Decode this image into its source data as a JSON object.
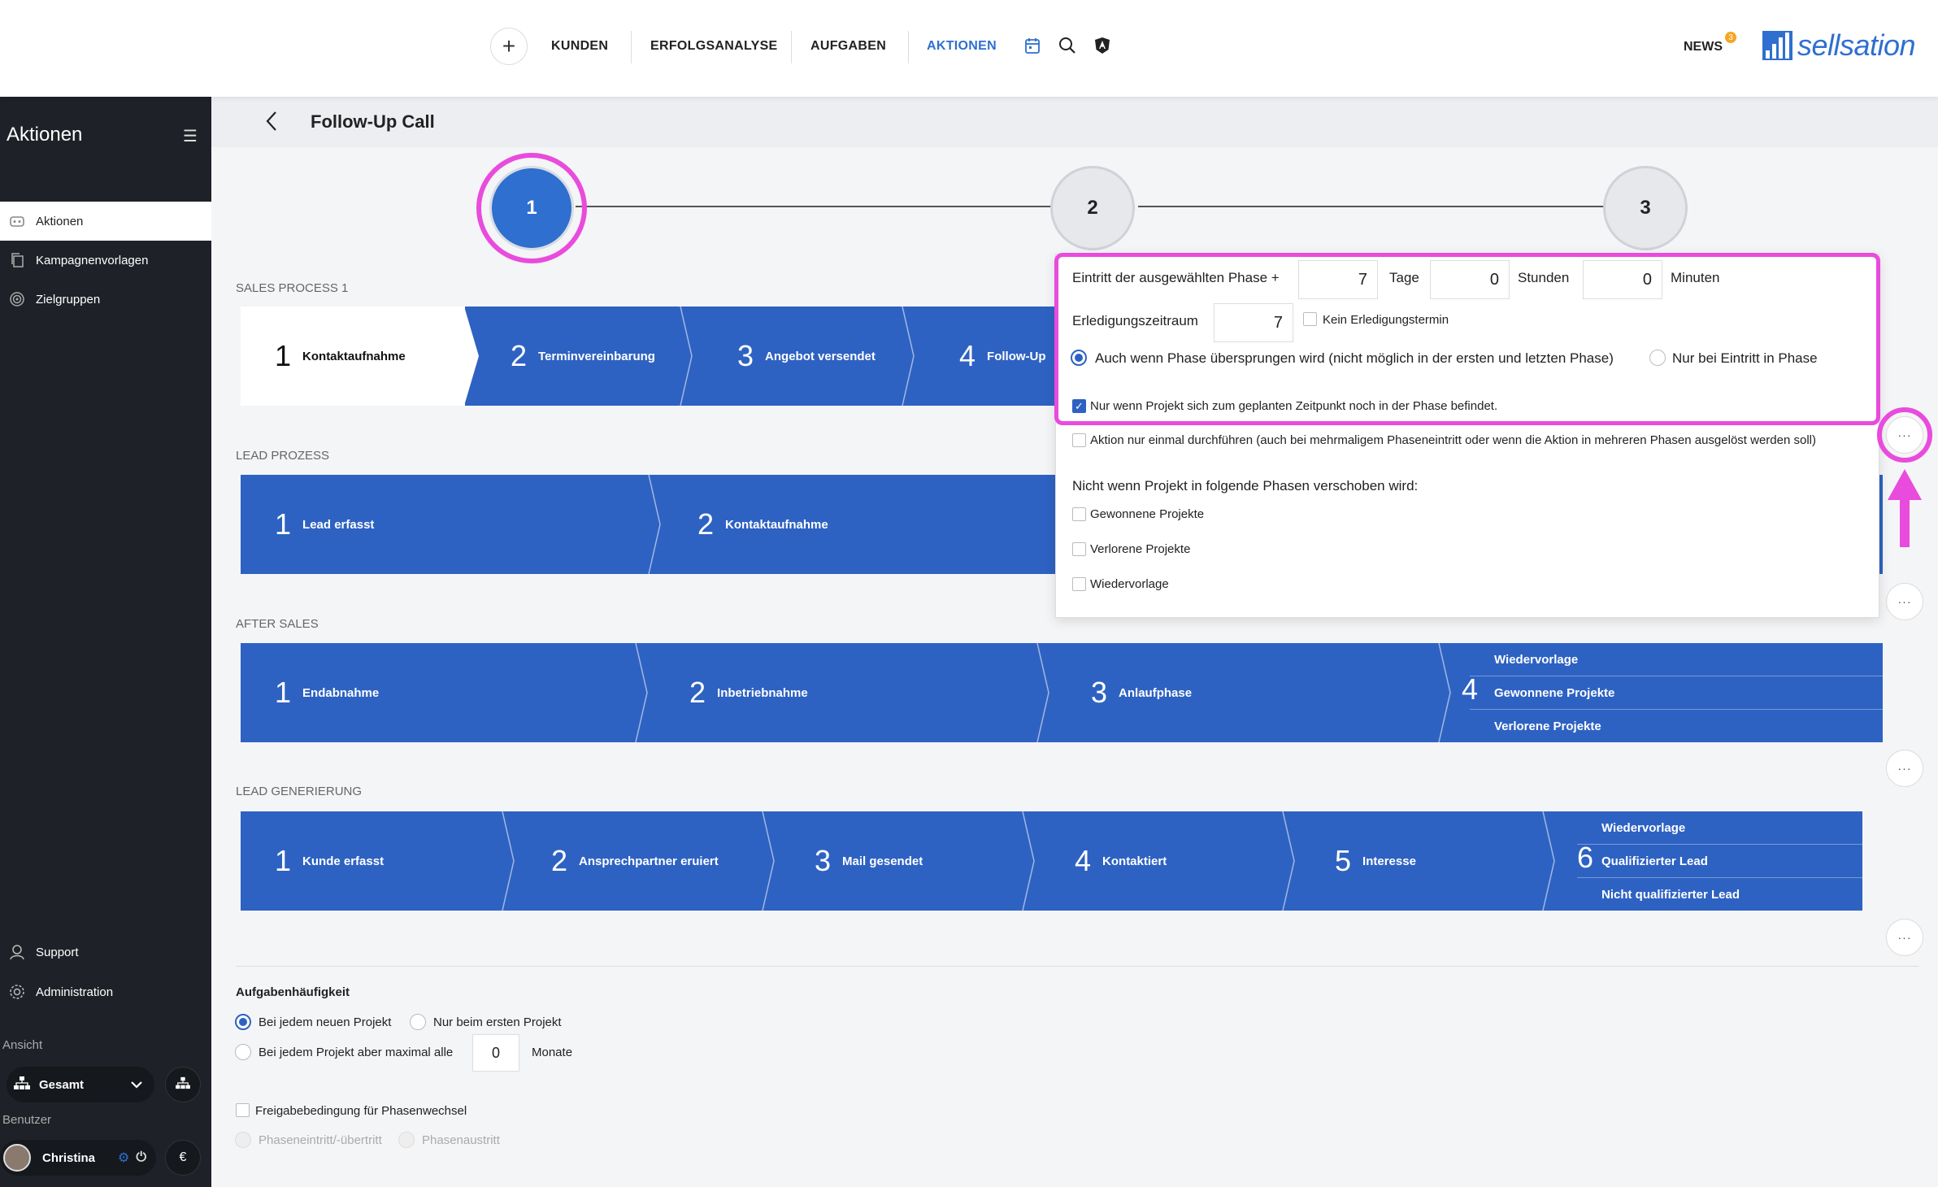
{
  "topnav": {
    "plus": "+",
    "items": [
      "KUNDEN",
      "ERFOLGSANALYSE",
      "AUFGABEN",
      "AKTIONEN"
    ],
    "active": "AKTIONEN",
    "news": "NEWS",
    "news_badge": "3",
    "logo": "sellsation",
    "accent": "#2e6fd0"
  },
  "sidebar": {
    "title": "Aktionen",
    "items": [
      {
        "label": "Aktionen",
        "icon": "robot-icon"
      },
      {
        "label": "Kampagnenvorlagen",
        "icon": "copy-icon"
      },
      {
        "label": "Zielgruppen",
        "icon": "target-icon"
      }
    ],
    "support": "Support",
    "administration": "Administration",
    "ansicht_label": "Ansicht",
    "ansicht_value": "Gesamt",
    "benutzer_label": "Benutzer",
    "user_name": "Christina",
    "currency": "€"
  },
  "header": {
    "title": "Follow-Up Call"
  },
  "stepper": {
    "steps": [
      "1",
      "2",
      "3"
    ],
    "active": "1"
  },
  "sections": [
    {
      "title": "SALES PROCESS 1",
      "stages": [
        {
          "num": "1",
          "label": "Kontaktaufnahme"
        },
        {
          "num": "2",
          "label": "Terminvereinbarung"
        },
        {
          "num": "3",
          "label": "Angebot versendet"
        },
        {
          "num": "4",
          "label": "Follow-Up"
        }
      ]
    },
    {
      "title": "LEAD PROZESS",
      "stages": [
        {
          "num": "1",
          "label": "Lead erfasst"
        },
        {
          "num": "2",
          "label": "Kontaktaufnahme"
        }
      ]
    },
    {
      "title": "AFTER SALES",
      "stages": [
        {
          "num": "1",
          "label": "Endabnahme"
        },
        {
          "num": "2",
          "label": "Inbetriebnahme"
        },
        {
          "num": "3",
          "label": "Anlaufphase"
        }
      ],
      "final": {
        "num": "4",
        "rows": [
          "Wiedervorlage",
          "Gewonnene Projekte",
          "Verlorene Projekte"
        ]
      }
    },
    {
      "title": "LEAD GENERIERUNG",
      "stages": [
        {
          "num": "1",
          "label": "Kunde erfasst"
        },
        {
          "num": "2",
          "label": "Ansprechpartner eruiert"
        },
        {
          "num": "3",
          "label": "Mail gesendet"
        },
        {
          "num": "4",
          "label": "Kontaktiert"
        },
        {
          "num": "5",
          "label": "Interesse"
        }
      ],
      "final": {
        "num": "6",
        "rows": [
          "Wiedervorlage",
          "Qualifizierter Lead",
          "Nicht qualifizierter Lead"
        ]
      }
    }
  ],
  "more_label": "···",
  "panel": {
    "entry_label": "Eintritt der ausgewählten Phase +",
    "days_value": "7",
    "days_label": "Tage",
    "hours_value": "0",
    "hours_label": "Stunden",
    "minutes_value": "0",
    "minutes_label": "Minuten",
    "period_label": "Erledigungszeitraum",
    "period_value": "7",
    "no_deadline": "Kein Erledigungstermin",
    "radio_skip": "Auch wenn Phase übersprungen wird (nicht möglich in der ersten und letzten Phase)",
    "radio_entry": "Nur bei Eintritt in Phase",
    "only_if_in_phase": "Nur wenn Projekt sich zum geplanten Zeitpunkt noch in der Phase befindet.",
    "only_once": "Aktion nur einmal durchführen (auch bei mehrmaligem Phaseneintritt oder wenn die Aktion in mehreren Phasen ausgelöst werden soll)",
    "not_if_heading": "Nicht wenn Projekt in folgende Phasen verschoben wird:",
    "not_if_options": [
      "Gewonnene Projekte",
      "Verlorene Projekte",
      "Wiedervorlage"
    ]
  },
  "frequency": {
    "title": "Aufgabenhäufigkeit",
    "opt_each_new": "Bei jedem neuen Projekt",
    "opt_first": "Nur beim ersten Projekt",
    "opt_max": "Bei jedem Projekt aber maximal alle",
    "months_value": "0",
    "months_label": "Monate",
    "release_label": "Freigabebedingung für Phasenwechsel",
    "phase_entry": "Phaseneintritt/-übertritt",
    "phase_exit": "Phasenaustritt"
  },
  "highlight_color": "#e94bdc"
}
